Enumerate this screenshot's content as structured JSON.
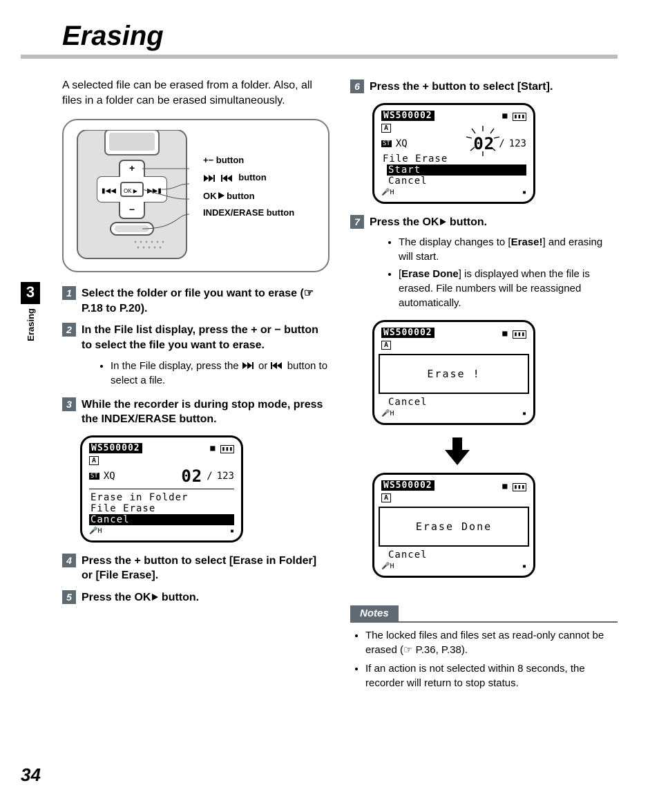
{
  "page": {
    "title": "Erasing",
    "chapter_number": "3",
    "chapter_label": "Erasing",
    "page_number": "34",
    "intro": "A selected file can be erased from a folder. Also, all files in a folder can be erased simultaneously."
  },
  "legend": {
    "plusminus": "+− button",
    "ffrw": " button",
    "ok": "OK",
    "ok_suffix": " button",
    "indexerase": "INDEX/ERASE button"
  },
  "steps": {
    "s1": "Select the folder or file you want to erase (☞ P.18 to P.20).",
    "s2": "In the File list display, press the + or − button to select the file you want to erase.",
    "s2_sub_a": "In the File display, press the ",
    "s2_sub_b": " or ",
    "s2_sub_c": " button to select a file.",
    "s3": "While the recorder is during stop mode, press the INDEX/ERASE button.",
    "s4_a": "Press the + button to select [",
    "s4_b": "Erase in Folder",
    "s4_c": "] or [",
    "s4_d": "File Erase",
    "s4_e": "].",
    "s5_a": "Press the ",
    "s5_ok": "OK",
    "s5_b": " button.",
    "s6_a": "Press the + button to select [",
    "s6_b": "Start",
    "s6_c": "].",
    "s7_a": "Press the ",
    "s7_ok": "OK",
    "s7_b": " button.",
    "s7_sub1_a": "The display changes to [",
    "s7_sub1_b": "Erase!",
    "s7_sub1_c": "] and erasing will start.",
    "s7_sub2_a": "[",
    "s7_sub2_b": "Erase Done",
    "s7_sub2_c": "] is displayed when the file is erased. File numbers will be reassigned automatically."
  },
  "lcd": {
    "model": "WS500002",
    "folder": "A",
    "st": "ST",
    "xq": "XQ",
    "count_cur": "02",
    "count_sep": "/",
    "count_total": "123",
    "menu1_a": "Erase in Folder",
    "menu1_b": "File Erase",
    "menu1_c": "Cancel",
    "menu2_title": "File Erase",
    "menu2_a": "Start",
    "menu2_b": "Cancel",
    "popup_erase": "Erase !",
    "popup_done": "Erase Done",
    "cancel": "Cancel",
    "stop": "■",
    "batt": "▮▮▮"
  },
  "notes": {
    "heading": "Notes",
    "n1": "The locked files and files set as read-only cannot be erased (☞ P.36, P.38).",
    "n2": "If an action is not selected within 8 seconds, the recorder will return to stop status."
  }
}
